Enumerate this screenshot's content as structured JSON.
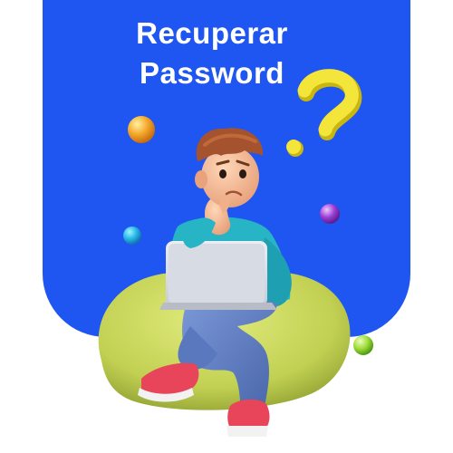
{
  "title": {
    "line1": "Recuperar",
    "line2": "Password"
  },
  "colors": {
    "card_blue": "#1f55f0",
    "text_white": "#ffffff",
    "question_mark_yellow": "#f3e33a",
    "bean_bag_green": "#c9d85c",
    "sweater_teal": "#27b4c4",
    "jeans_blue": "#5f80c6",
    "shoe_red": "#e8455a",
    "laptop_grey": "#d9dce3",
    "hair_brown": "#a5532e"
  },
  "icons": [
    "question-mark-icon",
    "orange-ball-icon",
    "blue-ball-icon",
    "purple-ball-icon",
    "green-ball-icon"
  ]
}
